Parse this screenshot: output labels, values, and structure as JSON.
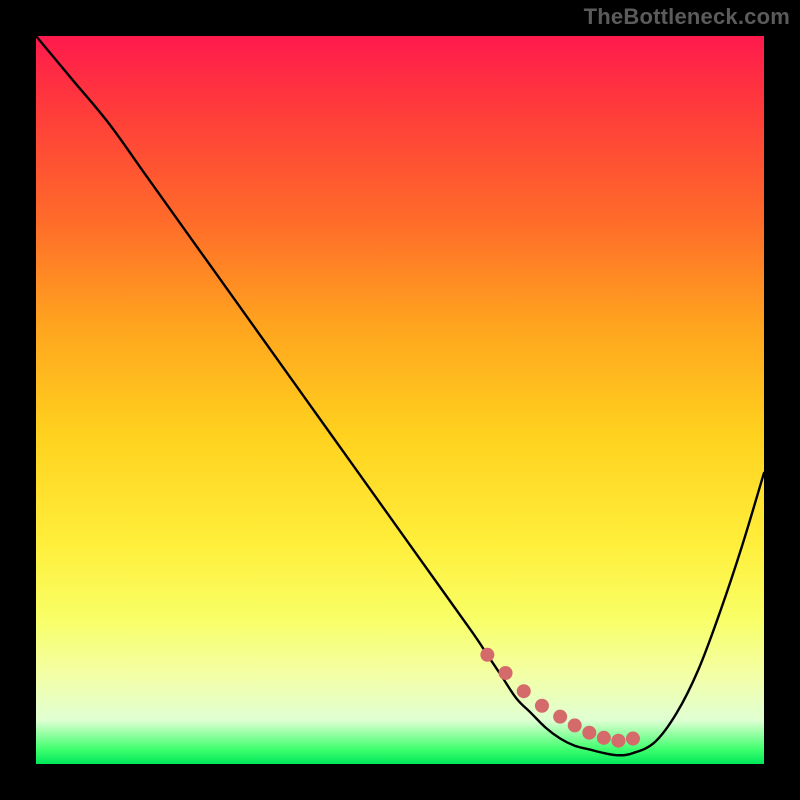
{
  "watermark": "TheBottleneck.com",
  "chart_data": {
    "type": "line",
    "title": "",
    "xlabel": "",
    "ylabel": "",
    "xlim": [
      0,
      100
    ],
    "ylim": [
      0,
      100
    ],
    "series": [
      {
        "name": "curve",
        "x": [
          0,
          5,
          10,
          15,
          20,
          25,
          30,
          35,
          40,
          45,
          50,
          55,
          60,
          62,
          64,
          66,
          68,
          70,
          72,
          74,
          76,
          78,
          80,
          82,
          85,
          88,
          91,
          94,
          97,
          100
        ],
        "values": [
          100,
          94,
          88,
          81,
          74,
          67,
          60,
          53,
          46,
          39,
          32,
          25,
          18,
          15,
          12,
          9,
          7,
          5,
          3.5,
          2.5,
          2,
          1.5,
          1.2,
          1.5,
          3,
          7,
          13,
          21,
          30,
          40
        ]
      }
    ],
    "markers": {
      "x": [
        62,
        64.5,
        67,
        69.5,
        72,
        74,
        76,
        78,
        80,
        82
      ],
      "values": [
        15,
        12.5,
        10,
        8,
        6.5,
        5.3,
        4.3,
        3.6,
        3.2,
        3.5
      ],
      "color": "#d46a6a",
      "radius_px": 7
    },
    "colors": {
      "curve": "#000000",
      "marker": "#d46a6a",
      "gradient_top": "#ff1a4d",
      "gradient_bottom": "#00e85a"
    }
  }
}
